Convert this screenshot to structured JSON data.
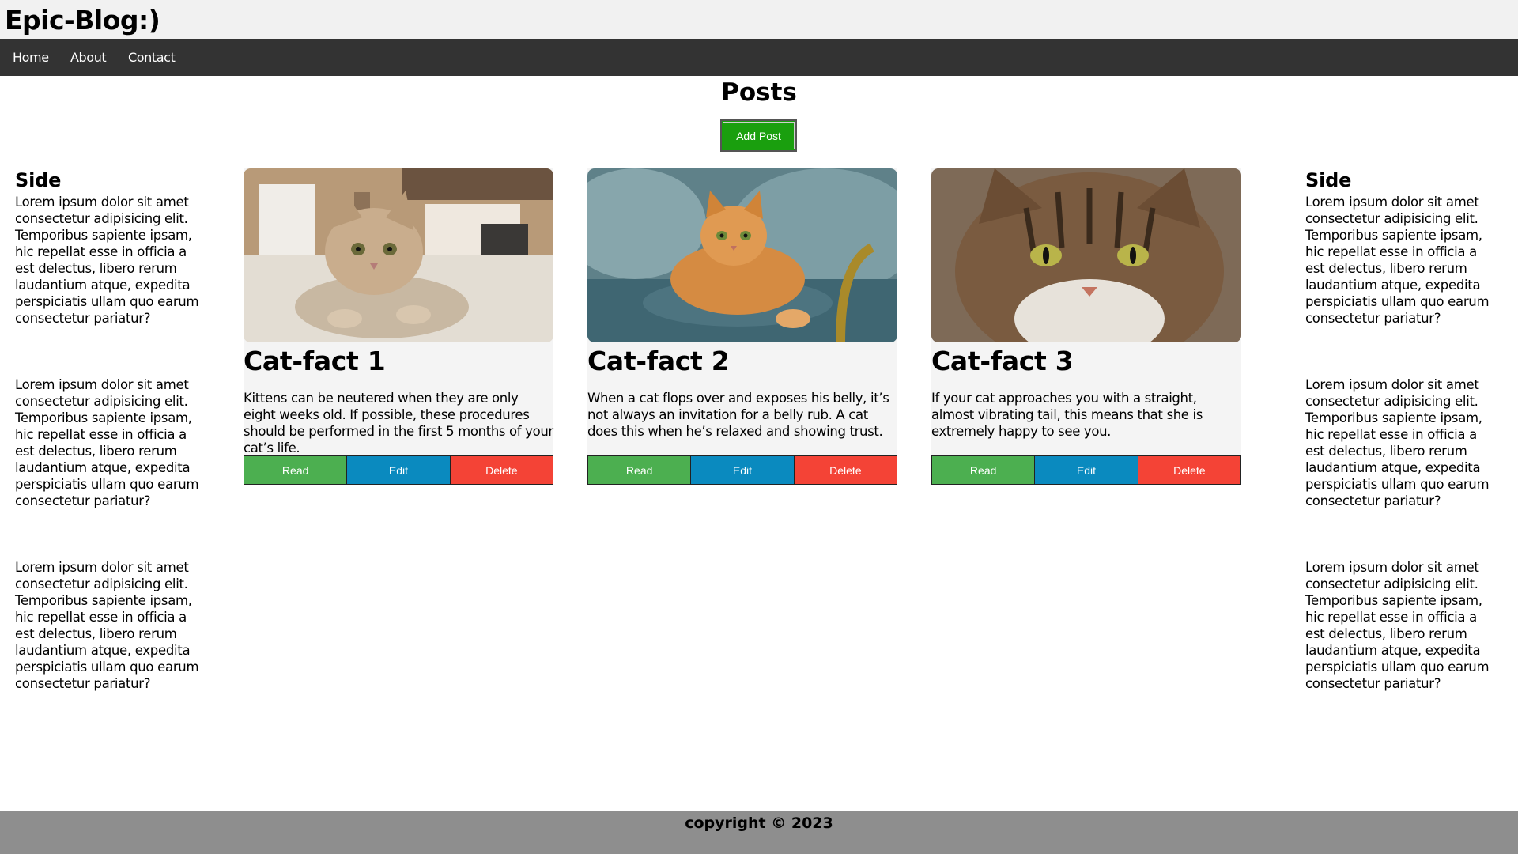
{
  "site": {
    "title": "Epic-Blog:)"
  },
  "nav": {
    "items": [
      {
        "label": "Home"
      },
      {
        "label": "About"
      },
      {
        "label": "Contact"
      }
    ]
  },
  "main": {
    "title": "Posts",
    "add_post_label": "Add Post"
  },
  "sidebar_left": {
    "heading": "Side",
    "paragraphs": [
      "Lorem ipsum dolor sit amet consectetur adipisicing elit. Temporibus sapiente ipsam, hic repellat esse in officia a est delectus, libero rerum laudantium atque, expedita perspiciatis ullam quo earum consectetur pariatur?",
      "Lorem ipsum dolor sit amet consectetur adipisicing elit. Temporibus sapiente ipsam, hic repellat esse in officia a est delectus, libero rerum laudantium atque, expedita perspiciatis ullam quo earum consectetur pariatur?",
      "Lorem ipsum dolor sit amet consectetur adipisicing elit. Temporibus sapiente ipsam, hic repellat esse in officia a est delectus, libero rerum laudantium atque, expedita perspiciatis ullam quo earum consectetur pariatur?"
    ]
  },
  "sidebar_right": {
    "heading": "Side",
    "paragraphs": [
      "Lorem ipsum dolor sit amet consectetur adipisicing elit. Temporibus sapiente ipsam, hic repellat esse in officia a est delectus, libero rerum laudantium atque, expedita perspiciatis ullam quo earum consectetur pariatur?",
      "Lorem ipsum dolor sit amet consectetur adipisicing elit. Temporibus sapiente ipsam, hic repellat esse in officia a est delectus, libero rerum laudantium atque, expedita perspiciatis ullam quo earum consectetur pariatur?",
      "Lorem ipsum dolor sit amet consectetur adipisicing elit. Temporibus sapiente ipsam, hic repellat esse in officia a est delectus, libero rerum laudantium atque, expedita perspiciatis ullam quo earum consectetur pariatur?"
    ]
  },
  "posts": [
    {
      "title": "Cat-fact 1",
      "text": "Kittens can be neutered when they are only eight weeks old. If possible, these procedures should be performed in the first 5 months of your cat’s life.",
      "image": "tabby-kitten-on-carpet",
      "read": "Read",
      "edit": "Edit",
      "delete": "Delete"
    },
    {
      "title": "Cat-fact 2",
      "text": "When a cat flops over and exposes his belly, it’s not always an invitation for a belly rub. A cat does this when he’s relaxed and showing trust.",
      "image": "orange-cat-on-couch",
      "read": "Read",
      "edit": "Edit",
      "delete": "Delete"
    },
    {
      "title": "Cat-fact 3",
      "text": "If your cat approaches you with a straight, almost vibrating tail, this means that she is extremely happy to see you.",
      "image": "tabby-cat-face-closeup",
      "read": "Read",
      "edit": "Edit",
      "delete": "Delete"
    }
  ],
  "colors": {
    "read": "#4caf50",
    "edit": "#0a8abf",
    "delete": "#f44336",
    "add_post": "#1a9f0e",
    "navbar": "#333333",
    "footer": "#8e8e8e"
  },
  "footer": {
    "text": "copyright © 2023"
  }
}
